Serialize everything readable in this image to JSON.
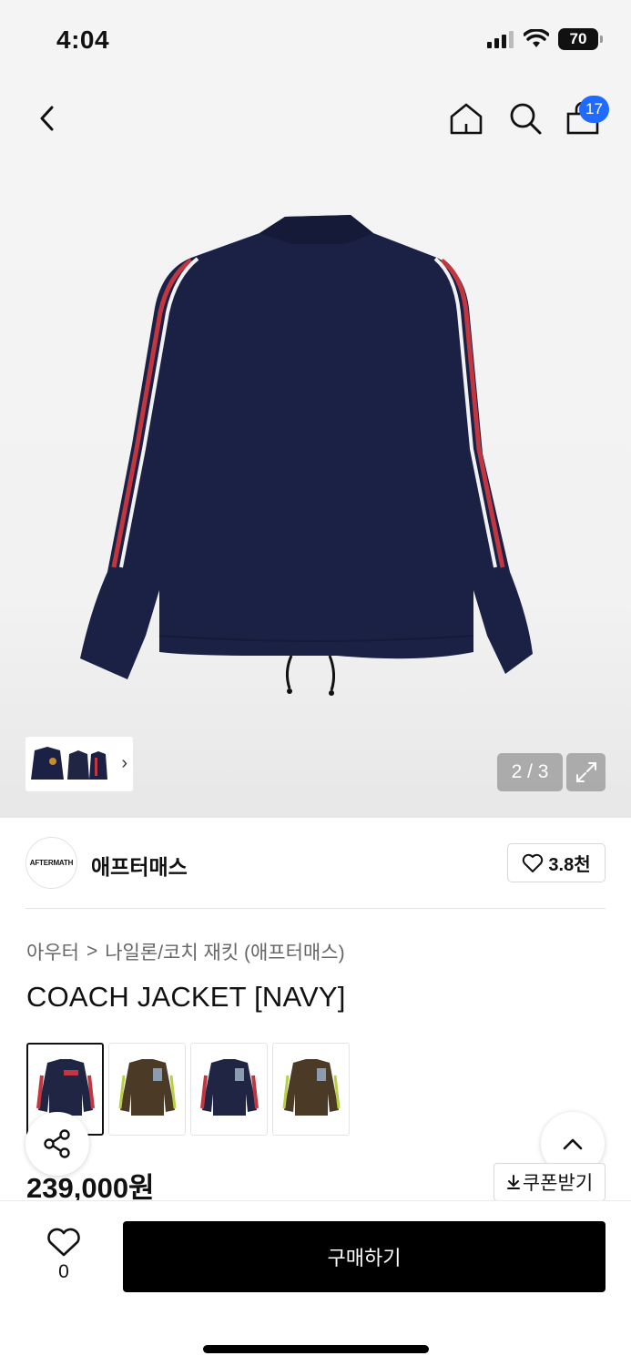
{
  "status_bar": {
    "time": "4:04",
    "battery": "70"
  },
  "header": {
    "back_icon": "chevron-left-icon",
    "home_icon": "home-icon",
    "search_icon": "search-icon",
    "bag_icon": "shopping-bag-icon",
    "cart_badge": "17"
  },
  "gallery": {
    "counter": "2 / 3",
    "thumbnail_arrow": "›"
  },
  "brand": {
    "logo_text": "AFTERMATH",
    "name": "애프터매스",
    "like_count": "3.8천"
  },
  "product": {
    "breadcrumb_parent": "아우터",
    "breadcrumb_separator": ">",
    "breadcrumb_child": "나일론/코치 재킷 (애프터매스)",
    "title": "COACH JACKET [NAVY]",
    "price": "239,000원",
    "coupon_label": "쿠폰받기",
    "swatch_colors": [
      "#1f2542",
      "#4a3a26",
      "#1f2542",
      "#4a3a26"
    ],
    "swatch_stripes": [
      "#c2373f",
      "#b7d042",
      "#c2373f",
      "#b7d042"
    ]
  },
  "bottom_bar": {
    "wish_count": "0",
    "buy_label": "구매하기"
  },
  "colors": {
    "accent_badge": "#1f6bff",
    "jacket_navy": "#1b2145",
    "buy_button": "#000000"
  }
}
